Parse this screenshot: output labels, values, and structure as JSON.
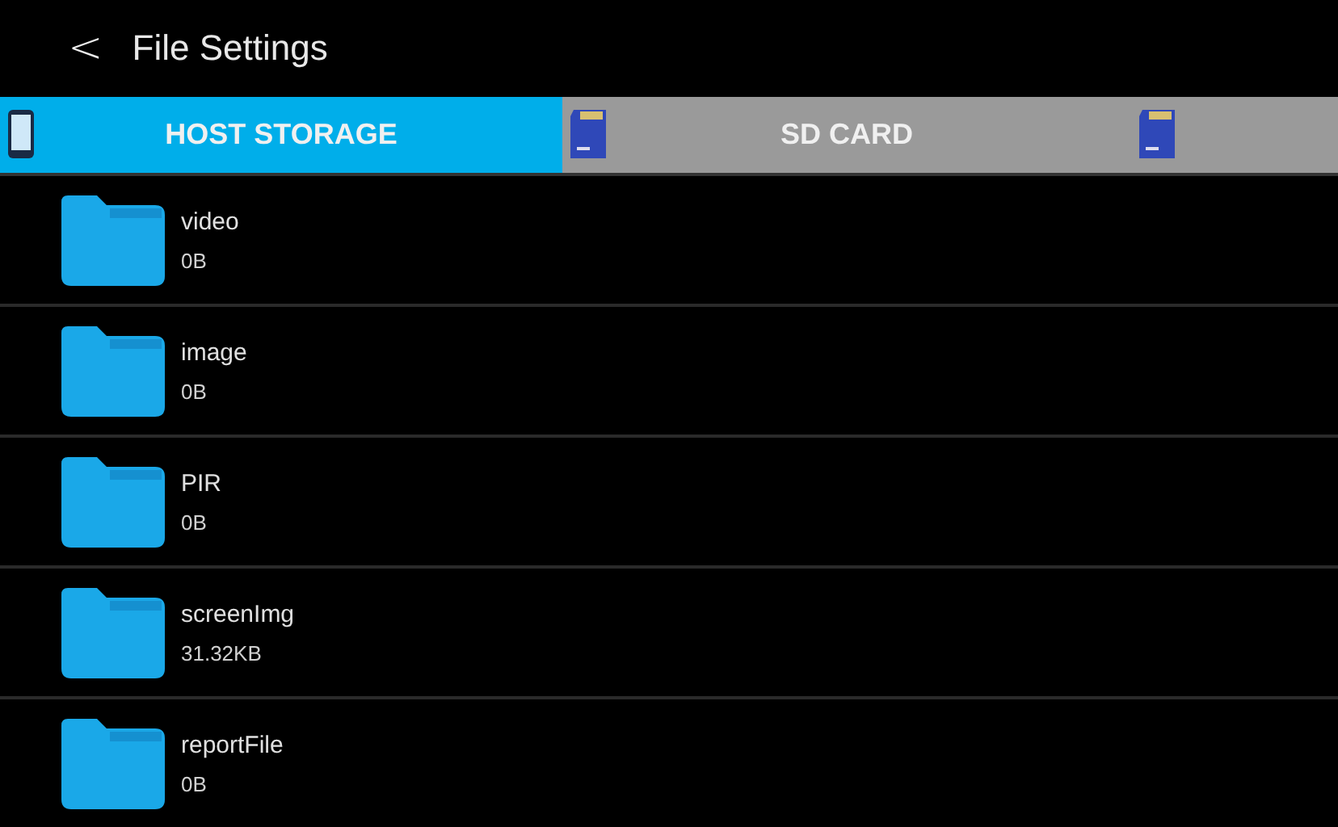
{
  "header": {
    "back": "<",
    "title": "File Settings"
  },
  "tabs": [
    {
      "label": "HOST STORAGE",
      "kind": "phone",
      "selected": true
    },
    {
      "label": "SD CARD",
      "kind": "sd",
      "selected": false
    },
    {
      "kind": "sd",
      "selected": false
    }
  ],
  "folders": [
    {
      "name": "video",
      "size": "0B"
    },
    {
      "name": "image",
      "size": "0B"
    },
    {
      "name": "PIR",
      "size": "0B"
    },
    {
      "name": "screenImg",
      "size": "31.32KB"
    },
    {
      "name": "reportFile",
      "size": "0B"
    }
  ]
}
